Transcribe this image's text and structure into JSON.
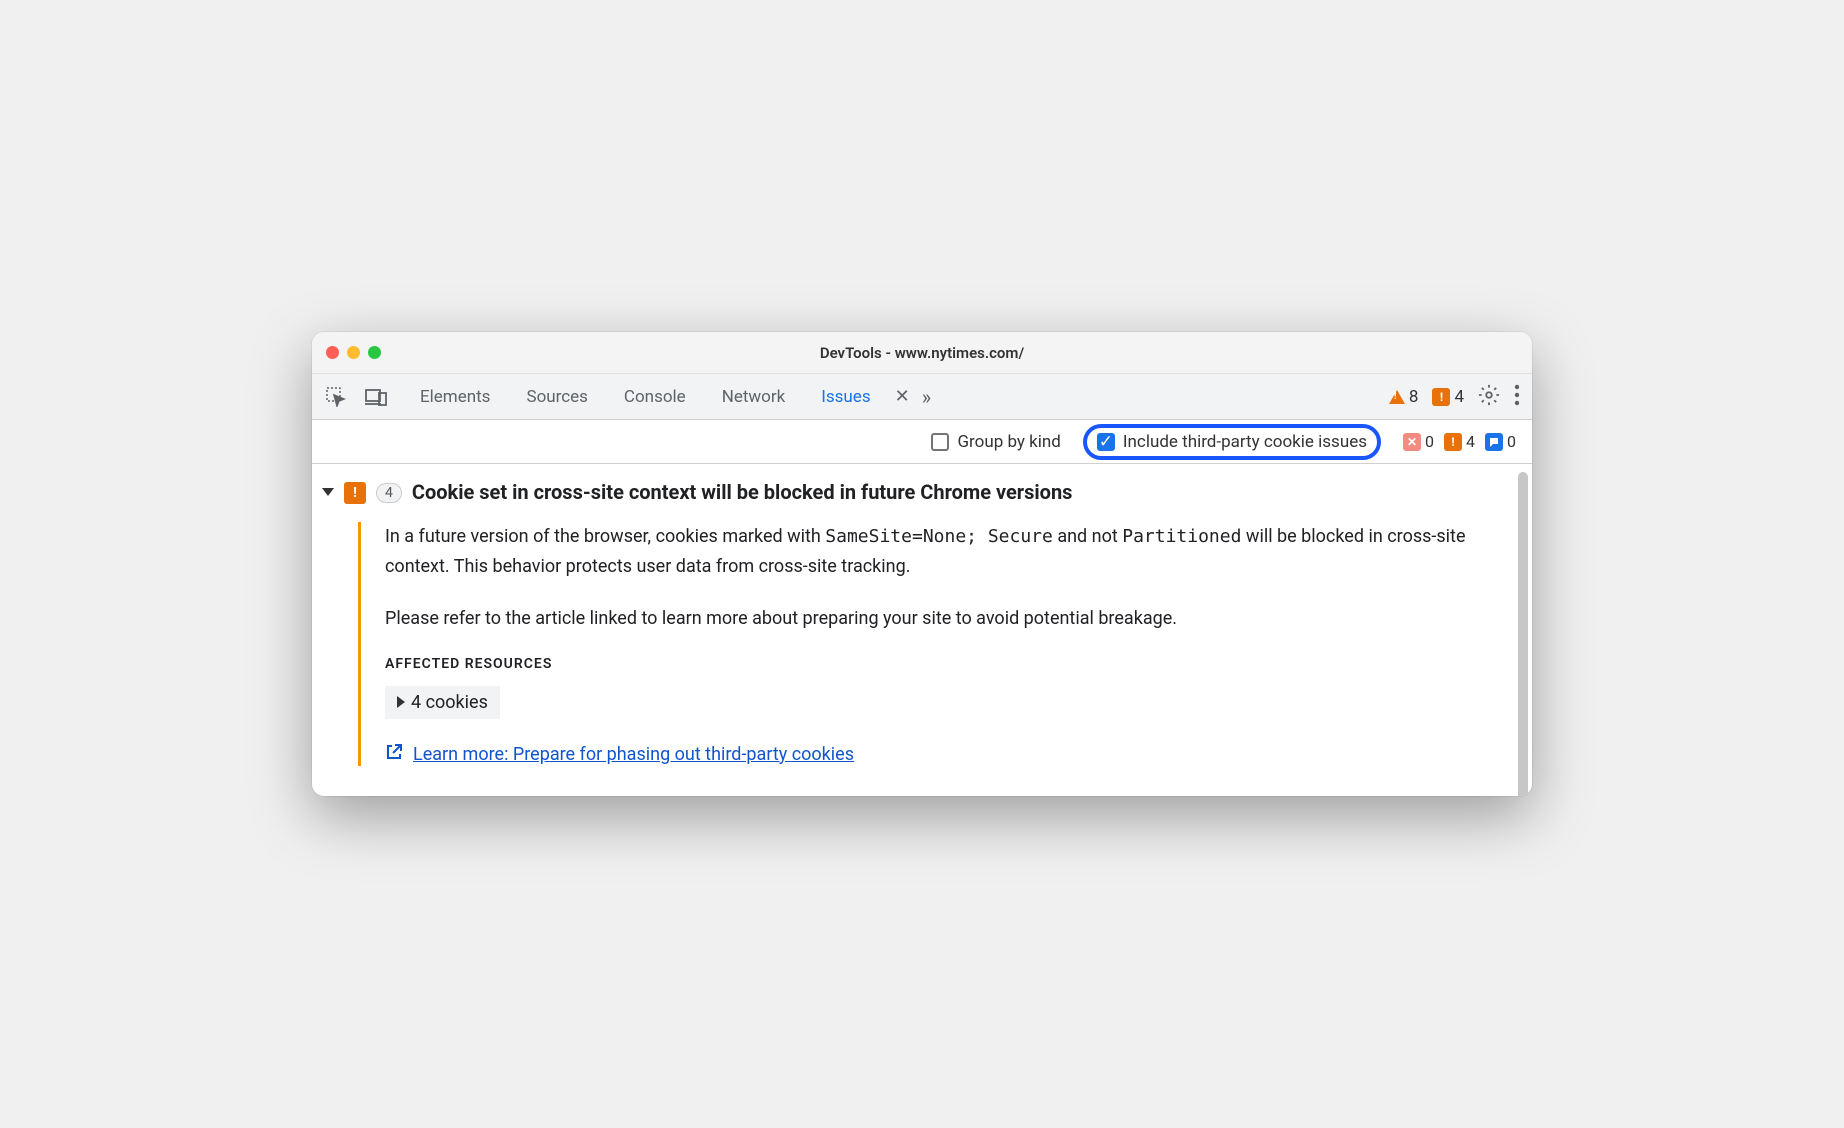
{
  "window": {
    "title": "DevTools - www.nytimes.com/"
  },
  "tabs": {
    "elements": "Elements",
    "sources": "Sources",
    "console": "Console",
    "network": "Network",
    "issues": "Issues"
  },
  "tabbar_counts": {
    "warnings": "8",
    "errors": "4"
  },
  "filter": {
    "group_by_kind": "Group by kind",
    "include_third_party": "Include third-party cookie issues"
  },
  "filter_counts": {
    "hidden": "0",
    "warn": "4",
    "info": "0"
  },
  "issue": {
    "count": "4",
    "title": "Cookie set in cross-site context will be blocked in future Chrome versions",
    "p1_a": "In a future version of the browser, cookies marked with ",
    "p1_code1": "SameSite=None; Secure",
    "p1_b": " and not ",
    "p1_code2": "Partitioned",
    "p1_c": " will be blocked in cross-site context. This behavior protects user data from cross-site tracking.",
    "p2": "Please refer to the article linked to learn more about preparing your site to avoid potential breakage.",
    "affected_label": "AFFECTED RESOURCES",
    "cookies_label": "4 cookies",
    "learn_more": "Learn more: Prepare for phasing out third-party cookies"
  }
}
